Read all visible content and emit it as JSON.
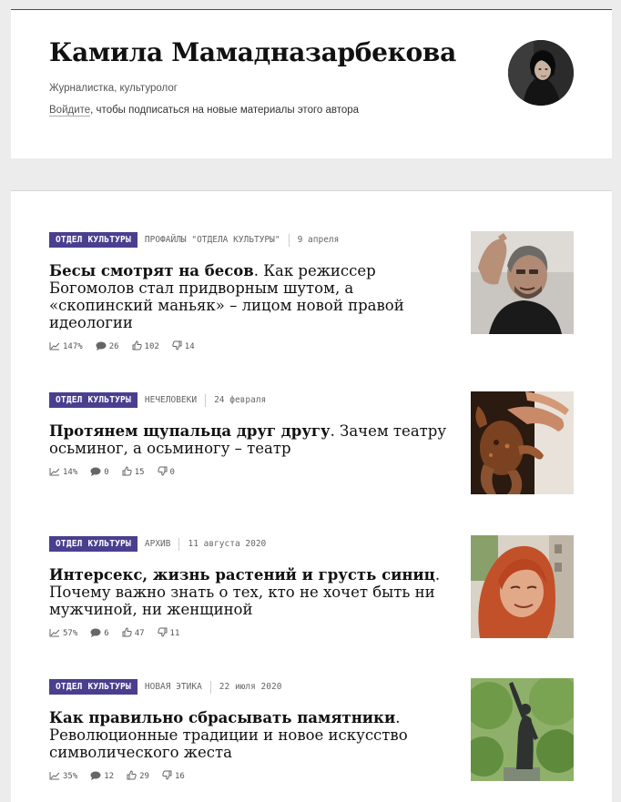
{
  "author": {
    "name": "Камила Мамадназарбекова",
    "role": "Журналистка, культуролог",
    "login_link": "Войдите",
    "subscribe_text": ", чтобы подписаться на новые материалы этого автора"
  },
  "articles": [
    {
      "rubric": "ОТДЕЛ КУЛЬТУРЫ",
      "section": "ПРОФАЙЛЫ \"ОТДЕЛА КУЛЬТУРЫ\"",
      "date": "9 апреля",
      "title_bold": "Бесы смотрят на бесов",
      "title_rest": ". Как режиссер Богомолов стал придворным шутом, а «скопинский маньяк» – лицом новой правой идеологии",
      "views": "147%",
      "comments": "26",
      "likes": "102",
      "dislikes": "14"
    },
    {
      "rubric": "ОТДЕЛ КУЛЬТУРЫ",
      "section": "НЕЧЕЛОВЕКИ",
      "date": "24 февраля",
      "title_bold": "Протянем щупальца друг другу",
      "title_rest": ". Зачем театру осьминог, а осьминогу – театр",
      "views": "14%",
      "comments": "0",
      "likes": "15",
      "dislikes": "0"
    },
    {
      "rubric": "ОТДЕЛ КУЛЬТУРЫ",
      "section": "АРХИВ",
      "date": "11 августа 2020",
      "title_bold": "Интерсекс, жизнь растений и грусть синиц",
      "title_rest": ". Почему важно знать о тех, кто не хочет быть ни мужчиной, ни женщиной",
      "views": "57%",
      "comments": "6",
      "likes": "47",
      "dislikes": "11"
    },
    {
      "rubric": "ОТДЕЛ КУЛЬТУРЫ",
      "section": "НОВАЯ ЭТИКА",
      "date": "22 июля 2020",
      "title_bold": "Как правильно сбрасывать памятники",
      "title_rest": ". Революционные традиции и новое искусство символического жеста",
      "views": "35%",
      "comments": "12",
      "likes": "29",
      "dislikes": "16"
    }
  ],
  "icons": {
    "views": "trend-chart-icon",
    "comments": "speech-bubble-icon",
    "likes": "thumbs-up-icon",
    "dislikes": "thumbs-down-icon"
  },
  "colors": {
    "rubric_bg": "#4a3f8f",
    "accent_line": "#4a3f99",
    "page_bg": "#ececec"
  }
}
